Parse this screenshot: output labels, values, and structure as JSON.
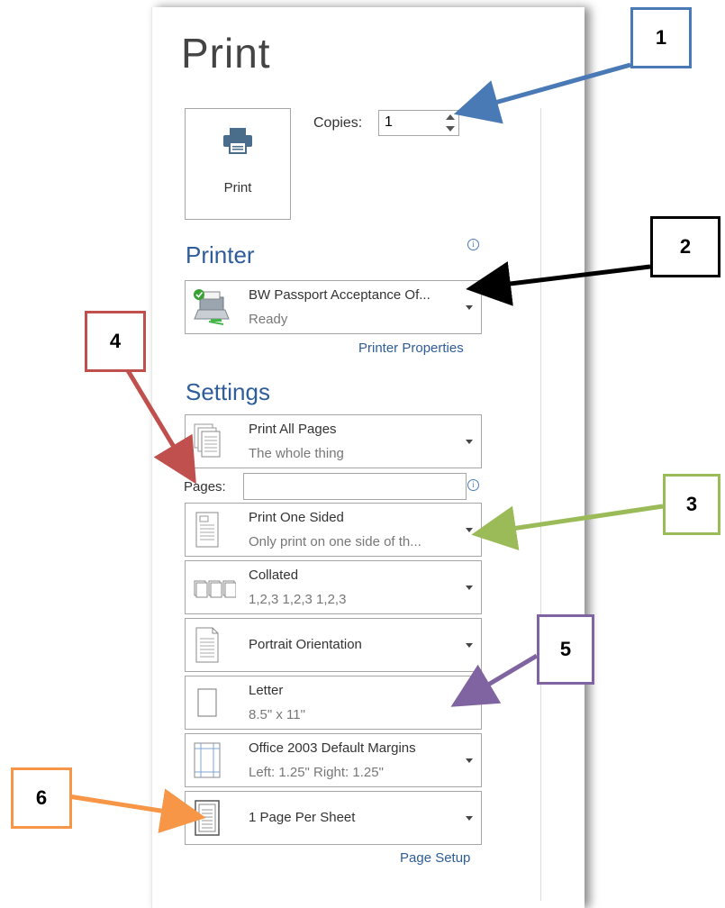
{
  "title": "Print",
  "print_button": {
    "label": "Print"
  },
  "copies": {
    "label": "Copies:",
    "value": "1"
  },
  "printer": {
    "heading": "Printer",
    "name": "BW Passport Acceptance Of...",
    "status": "Ready",
    "properties_link": "Printer Properties"
  },
  "settings": {
    "heading": "Settings",
    "pages_label": "Pages:",
    "pages_value": "",
    "items": [
      {
        "main": "Print All Pages",
        "sub": "The whole thing"
      },
      {
        "main": "Print One Sided",
        "sub": "Only print on one side of th..."
      },
      {
        "main": "Collated",
        "sub": "1,2,3   1,2,3   1,2,3"
      },
      {
        "main": "Portrait Orientation",
        "sub": ""
      },
      {
        "main": "Letter",
        "sub": "8.5\" x 11\""
      },
      {
        "main": "Office 2003 Default Margins",
        "sub": "Left:  1.25\"    Right:  1.25\""
      },
      {
        "main": "1 Page Per Sheet",
        "sub": ""
      }
    ],
    "page_setup_link": "Page Setup"
  },
  "callouts": [
    {
      "number": "1",
      "color": "#4a7ab5"
    },
    {
      "number": "2",
      "color": "#000000"
    },
    {
      "number": "3",
      "color": "#9bbb59"
    },
    {
      "number": "4",
      "color": "#c0504d"
    },
    {
      "number": "5",
      "color": "#8064a2"
    },
    {
      "number": "6",
      "color": "#f79646"
    }
  ]
}
